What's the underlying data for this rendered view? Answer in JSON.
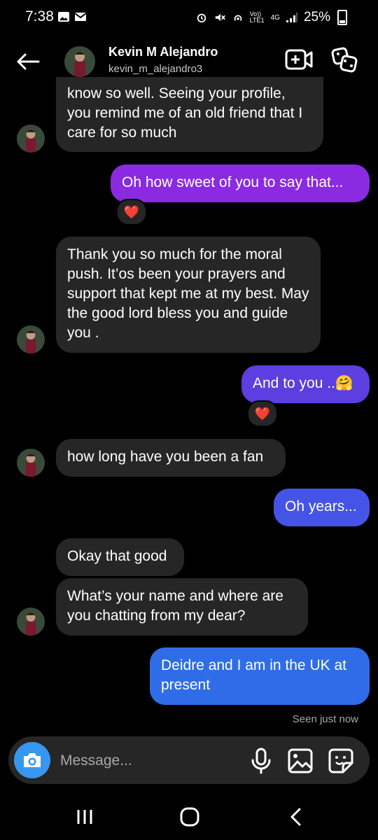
{
  "status_bar": {
    "time": "7:38",
    "network_label": "Vo)) LTE1",
    "network_type": "4G",
    "battery": "25%"
  },
  "header": {
    "name": "Kevin M Alejandro",
    "handle": "kevin_m_alejandro3"
  },
  "messages": [
    {
      "from": "them",
      "text": "know so well. Seeing your profile, you remind me of an old friend that I care for so much"
    },
    {
      "from": "me",
      "text": "Oh how sweet of you to say that...",
      "reaction": "❤️"
    },
    {
      "from": "them",
      "text": "Thank  you  so much for the moral push. It’os been your prayers and support that kept me at my best. May the good lord bless you and guide you ."
    },
    {
      "from": "me",
      "text": "And to you ..🤗",
      "reaction": "❤️"
    },
    {
      "from": "them",
      "text": "how long have you been a fan"
    },
    {
      "from": "me",
      "text": "Oh years..."
    },
    {
      "from": "them",
      "text": "Okay that good"
    },
    {
      "from": "them",
      "text": "What’s your name and where are you chatting from my dear?"
    },
    {
      "from": "me",
      "text": "Deidre and I am in the UK at present"
    }
  ],
  "seen_label": "Seen just now",
  "composer": {
    "placeholder": "Message..."
  },
  "colors": {
    "bubble_in": "#262626",
    "gradient_purple": "#8a2be2",
    "gradient_indigo": "#5b3fe0",
    "gradient_blue": "#2f6de8",
    "accent_blue": "#3797f0",
    "heart": "#ff2d55"
  },
  "icons": [
    "back-arrow-icon",
    "video-call-icon",
    "games-icon",
    "camera-icon",
    "microphone-icon",
    "gallery-icon",
    "sticker-icon",
    "recents-icon",
    "home-icon",
    "back-icon"
  ]
}
